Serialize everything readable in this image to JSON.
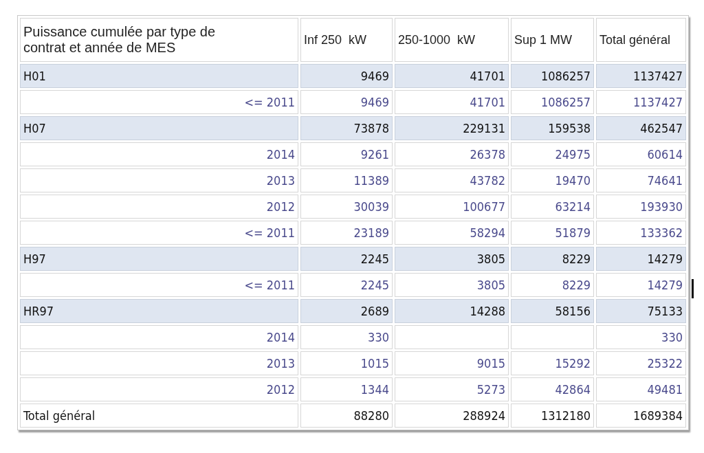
{
  "table": {
    "columns": [
      "Puissance cumulée par type de contrat et année de MES",
      "Inf 250  kW",
      "250-1000  kW",
      "Sup 1 MW",
      "Total général"
    ],
    "rows": [
      {
        "kind": "group",
        "label": "H01",
        "inf_250_kw": "9469",
        "kw_250_1000": "41701",
        "sup_1_mw": "1086257",
        "total": "1137427"
      },
      {
        "kind": "detail",
        "label": "<= 2011",
        "inf_250_kw": "9469",
        "kw_250_1000": "41701",
        "sup_1_mw": "1086257",
        "total": "1137427"
      },
      {
        "kind": "group",
        "label": "H07",
        "inf_250_kw": "73878",
        "kw_250_1000": "229131",
        "sup_1_mw": "159538",
        "total": "462547"
      },
      {
        "kind": "detail",
        "label": "2014",
        "inf_250_kw": "9261",
        "kw_250_1000": "26378",
        "sup_1_mw": "24975",
        "total": "60614"
      },
      {
        "kind": "detail",
        "label": "2013",
        "inf_250_kw": "11389",
        "kw_250_1000": "43782",
        "sup_1_mw": "19470",
        "total": "74641"
      },
      {
        "kind": "detail",
        "label": "2012",
        "inf_250_kw": "30039",
        "kw_250_1000": "100677",
        "sup_1_mw": "63214",
        "total": "193930"
      },
      {
        "kind": "detail",
        "label": "<= 2011",
        "inf_250_kw": "23189",
        "kw_250_1000": "58294",
        "sup_1_mw": "51879",
        "total": "133362"
      },
      {
        "kind": "group",
        "label": "H97",
        "inf_250_kw": "2245",
        "kw_250_1000": "3805",
        "sup_1_mw": "8229",
        "total": "14279"
      },
      {
        "kind": "detail",
        "label": "<= 2011",
        "inf_250_kw": "2245",
        "kw_250_1000": "3805",
        "sup_1_mw": "8229",
        "total": "14279"
      },
      {
        "kind": "group",
        "label": "HR97",
        "inf_250_kw": "2689",
        "kw_250_1000": "14288",
        "sup_1_mw": "58156",
        "total": "75133"
      },
      {
        "kind": "detail",
        "label": "2014",
        "inf_250_kw": "330",
        "total": "330"
      },
      {
        "kind": "detail",
        "label": "2013",
        "inf_250_kw": "1015",
        "kw_250_1000": "9015",
        "sup_1_mw": "15292",
        "total": "25322"
      },
      {
        "kind": "detail",
        "label": "2012",
        "inf_250_kw": "1344",
        "kw_250_1000": "5273",
        "sup_1_mw": "42864",
        "total": "49481"
      },
      {
        "kind": "total",
        "label": "Total général",
        "inf_250_kw": "88280",
        "kw_250_1000": "288924",
        "sup_1_mw": "1312180",
        "total": "1689384"
      }
    ]
  }
}
